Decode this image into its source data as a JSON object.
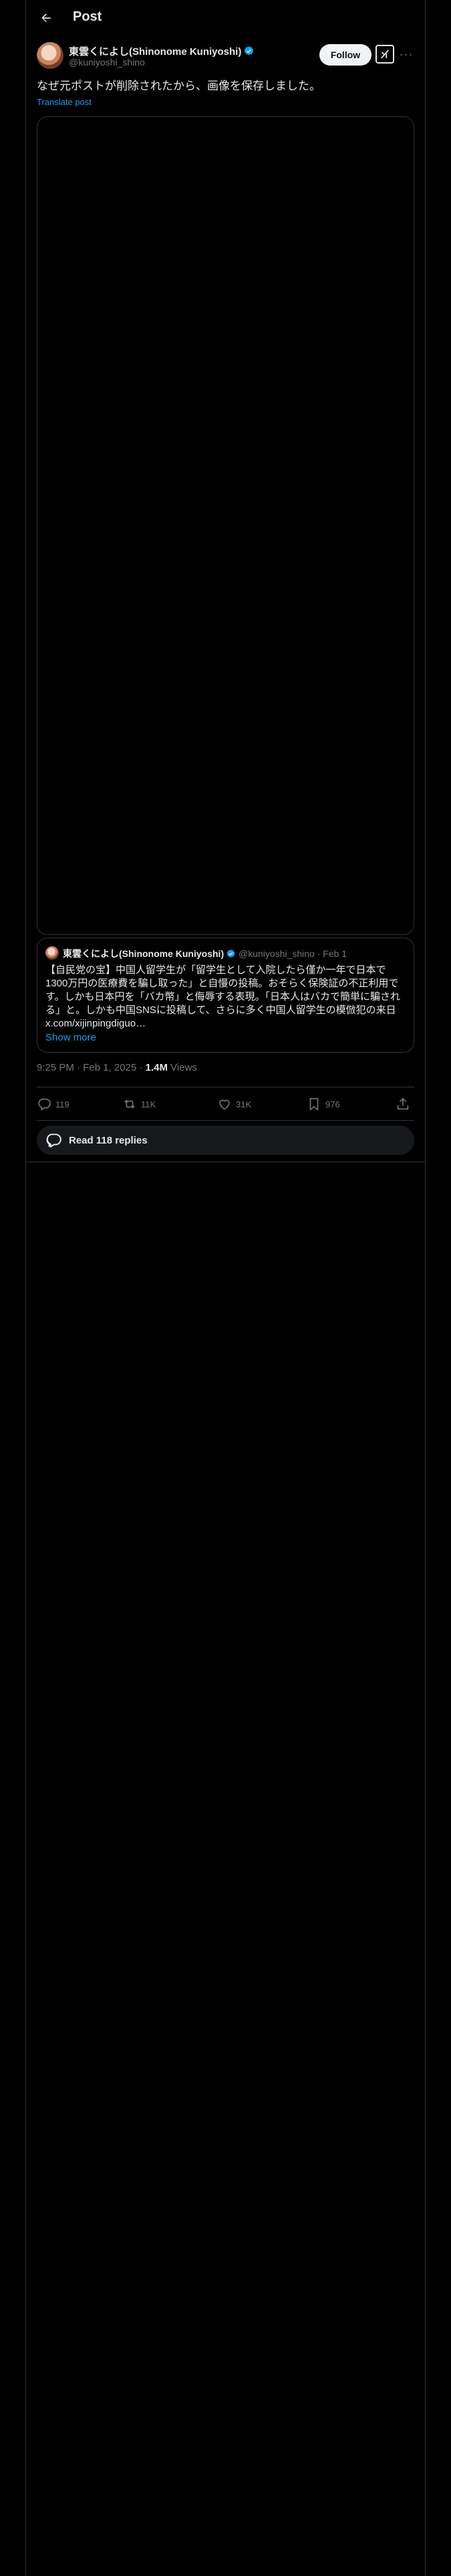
{
  "header": {
    "title": "Post"
  },
  "post": {
    "author_name": "東雲くによし(Shinonome Kuniyoshi)",
    "author_handle": "@kuniyoshi_shino",
    "follow_label": "Follow",
    "more_label": "···",
    "text": "なぜ元ポストが削除されたから、画像を保存しました。",
    "translate_label": "Translate post"
  },
  "quote": {
    "name": "東雲くによし(Shinonome Kuniyoshi)",
    "handle": "@kuniyoshi_shino",
    "sep": "·",
    "date": "Feb 1",
    "text": "【自民党の宝】中国人留学生が「留学生として入院したら僅か一年で日本で1300万円の医療費を騙し取った」と自慢の投稿。おそらく保険証の不正利用です。しかも日本円を「バカ幣」と侮辱する表現。「日本人はバカで簡単に騙される」と。しかも中国SNSに投稿して、さらに多く中国人留学生の模倣犯の来日 x.com/xijinpingdiguo…",
    "show_more": "Show more"
  },
  "meta": {
    "time": "9:25 PM",
    "sep": "·",
    "date": "Feb 1, 2025",
    "views_count": "1.4M",
    "views_label": "Views"
  },
  "actions": {
    "replies": "119",
    "reposts": "11K",
    "likes": "31K",
    "bookmarks": "976"
  },
  "read_replies": "Read 118 replies",
  "colors": {
    "accent": "#1d9bf0",
    "background": "#000000",
    "border": "#2f3336"
  }
}
